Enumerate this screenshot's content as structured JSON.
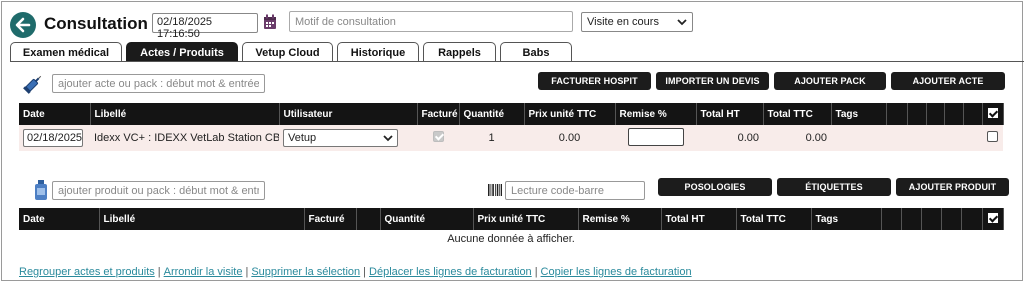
{
  "header": {
    "title": "Consultation",
    "datetime": "02/18/2025 17:16:50",
    "motif_placeholder": "Motif de consultation",
    "visite_status": "Visite en cours"
  },
  "tabs": [
    {
      "label": "Examen médical",
      "active": false
    },
    {
      "label": "Actes / Produits",
      "active": true
    },
    {
      "label": "Vetup Cloud",
      "active": false
    },
    {
      "label": "Historique",
      "active": false
    },
    {
      "label": "Rappels",
      "active": false
    },
    {
      "label": "Babs",
      "active": false
    }
  ],
  "actes": {
    "search_placeholder": "ajouter acte ou pack : début mot & entrée",
    "buttons": {
      "facturer": "FACTURER HOSPIT",
      "importer": "IMPORTER UN DEVIS",
      "pack": "AJOUTER PACK",
      "acte": "AJOUTER ACTE"
    },
    "columns": [
      "Date",
      "Libellé",
      "Utilisateur",
      "Facturé",
      "Quantité",
      "Prix unité TTC",
      "Remise %",
      "Total HT",
      "Total TTC",
      "Tags"
    ],
    "rows": [
      {
        "date": "02/18/2025",
        "libelle": "Idexx VC+ : IDEXX VetLab Station CBC, C",
        "utilisateur": "Vetup",
        "facture": true,
        "quantite": "1",
        "prix_unite_ttc": "0.00",
        "remise": "",
        "total_ht": "0.00",
        "total_ttc": "0.00",
        "tags": ""
      }
    ]
  },
  "produits": {
    "search_placeholder": "ajouter produit ou pack : début mot & entrée",
    "barcode_placeholder": "Lecture code-barre",
    "buttons": {
      "posologies": "POSOLOGIES",
      "etiquettes": "ÉTIQUETTES",
      "ajouter": "AJOUTER PRODUIT"
    },
    "columns": [
      "Date",
      "Libellé",
      "Facturé",
      "Quantité",
      "Prix unité TTC",
      "Remise %",
      "Total HT",
      "Total TTC",
      "Tags"
    ],
    "empty_message": "Aucune donnée à afficher."
  },
  "footer_links": [
    "Regrouper actes et produits",
    "Arrondir la visite",
    "Supprimer la sélection",
    "Déplacer les lignes de facturation",
    "Copier les lignes de facturation"
  ],
  "colors": {
    "accent": "#1f6b6b",
    "header_bg": "#141414",
    "row_bg": "#f8ecea",
    "link": "#2a8a9c",
    "calendar": "#6b3c6b"
  },
  "icons": [
    "back-arrow-icon",
    "calendar-icon",
    "syringe-icon",
    "bottle-icon",
    "barcode-icon",
    "chevron-down-icon",
    "check-icon"
  ]
}
